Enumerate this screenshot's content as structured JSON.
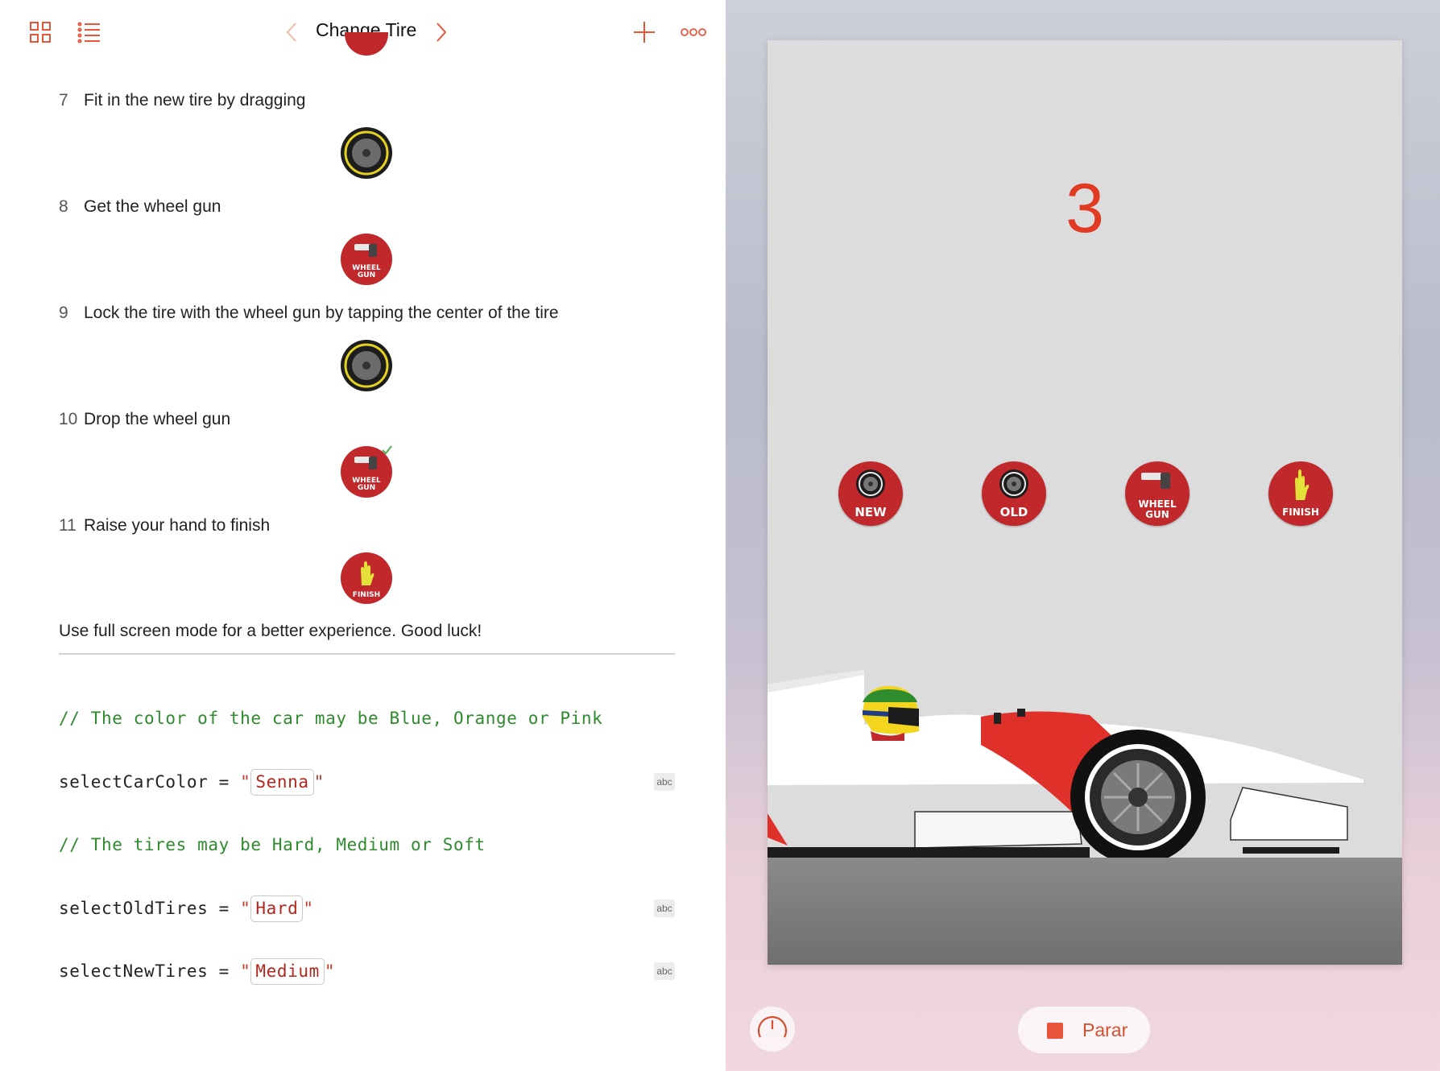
{
  "toolbar": {
    "title": "Change Tire",
    "icons": [
      "grid-icon",
      "list-icon",
      "chevron-left-icon",
      "chevron-right-icon",
      "plus-icon",
      "more-icon"
    ]
  },
  "steps": [
    {
      "num": "7",
      "text": "Fit in the new tire by dragging",
      "icon": "tire-icon"
    },
    {
      "num": "8",
      "text": "Get the wheel gun",
      "icon": "wheel-gun-icon",
      "icon_label": "WHEEL GUN"
    },
    {
      "num": "9",
      "text": "Lock the tire with the wheel gun by tapping the center of the tire",
      "icon": "tire-icon"
    },
    {
      "num": "10",
      "text": "Drop the wheel gun",
      "icon": "wheel-gun-checked-icon",
      "icon_label": "WHEEL GUN"
    },
    {
      "num": "11",
      "text": "Raise your hand to finish",
      "icon": "finish-hand-icon",
      "icon_label": "FINISH"
    }
  ],
  "final_text": "Use full screen mode for a better experience. Good luck!",
  "code": {
    "comment_color": "// The color of the car may be Blue, Orange or Pink",
    "color_var": "selectCarColor",
    "color_value": "Senna",
    "comment_tires": "// The tires may be Hard, Medium or Soft",
    "old_var": "selectOldTires",
    "old_value": "Hard",
    "new_var": "selectNewTires",
    "new_value": "Medium",
    "operator": "=",
    "quote": "\"",
    "abc": "abc"
  },
  "game": {
    "countdown": "3",
    "buttons": [
      {
        "label": "NEW",
        "icon": "tire-icon"
      },
      {
        "label": "OLD",
        "icon": "tire-icon"
      },
      {
        "label": "WHEEL GUN",
        "label_line1": "WHEEL",
        "label_line2": "GUN",
        "icon": "wheel-gun-icon"
      },
      {
        "label": "FINISH",
        "icon": "hand-icon"
      }
    ]
  },
  "controls": {
    "stop_label": "Parar"
  },
  "colors": {
    "accent": "#e8553a",
    "button_red": "#c0282b",
    "comment_green": "#2e8b2e",
    "string_red": "#b3261e"
  }
}
